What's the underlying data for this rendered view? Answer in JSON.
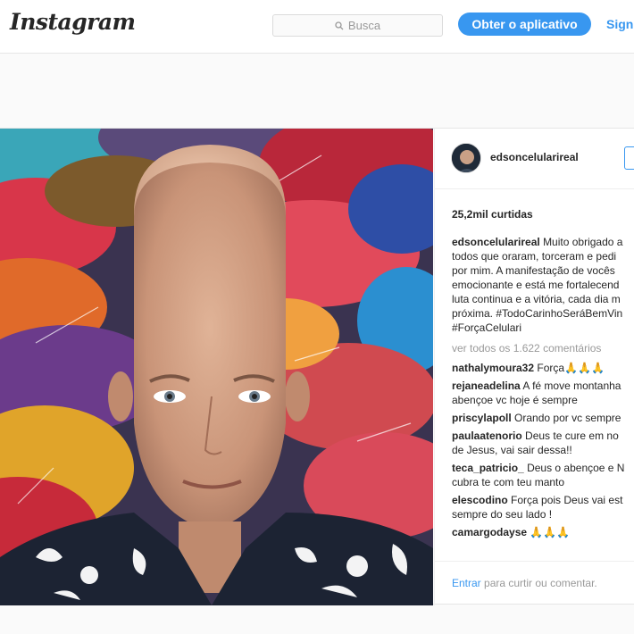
{
  "header": {
    "logo": "Instagram",
    "search_placeholder": "Busca",
    "get_app_label": "Obter o aplicativo",
    "sign_in_label": "Sign"
  },
  "post": {
    "username": "edsoncelularireal",
    "likes": "25,2mil curtidas",
    "caption_lines": [
      "Muito obrigado a",
      "todos que oraram, torceram e pedi",
      "por mim. A manifestação de vocês",
      "emocionante e está me fortalecend",
      "luta continua e a vitória, cada dia m",
      "próxima. #TodoCarinhoSeráBemVin",
      "#ForçaCelulari"
    ],
    "view_all_comments": "ver todos os 1.622 comentários",
    "comments": [
      {
        "user": "nathalymoura32",
        "lines": [
          "Força🙏🙏🙏"
        ]
      },
      {
        "user": "rejaneadelina",
        "lines": [
          "A fé move montanha",
          "abençoe vc hoje é sempre"
        ]
      },
      {
        "user": "priscylapoll",
        "lines": [
          "Orando por vc sempre"
        ]
      },
      {
        "user": "paulaatenorio",
        "lines": [
          "Deus te cure em no",
          "de Jesus, vai sair dessa!!"
        ]
      },
      {
        "user": "teca_patricio_",
        "lines": [
          "Deus o abençoe e N",
          "cubra te com teu manto"
        ]
      },
      {
        "user": "elescodino",
        "lines": [
          "Força pois Deus vai est",
          "sempre do seu lado !"
        ]
      },
      {
        "user": "camargodayse",
        "lines": [
          "🙏🙏🙏"
        ]
      }
    ],
    "comment_bar": {
      "entrar": "Entrar",
      "rest": "para curtir ou comentar."
    }
  },
  "colors": {
    "accent": "#3897f0",
    "text": "#262626",
    "muted": "#999999"
  }
}
